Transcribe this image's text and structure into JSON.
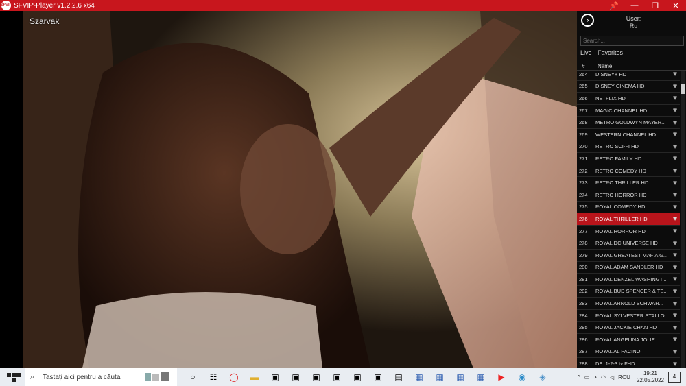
{
  "window": {
    "title": "SFVIP-Player v1.2.2.6 x64",
    "logo_text": "SFVIP",
    "controls": {
      "pin": "📌",
      "minimize": "—",
      "restore": "❐",
      "close": "✕"
    }
  },
  "video": {
    "channel_label": "Szarvak"
  },
  "panel": {
    "nav_arrow": "›",
    "user_label": "User:",
    "user_value": "Ru",
    "search_placeholder": "Search...",
    "tabs": {
      "live": "Live",
      "favorites": "Favorites"
    },
    "columns": {
      "num": "#",
      "name": "Name"
    },
    "channels": [
      {
        "num": "264",
        "name": "DISNEY+ HD"
      },
      {
        "num": "265",
        "name": "DISNEY CINEMA HD"
      },
      {
        "num": "266",
        "name": "NETFLIX HD"
      },
      {
        "num": "267",
        "name": "MAGIC CHANNEL HD"
      },
      {
        "num": "268",
        "name": "METRO GOLDWYN MAYER..."
      },
      {
        "num": "269",
        "name": "WESTERN CHANNEL HD"
      },
      {
        "num": "270",
        "name": "RETRO SCI-FI HD"
      },
      {
        "num": "271",
        "name": "RETRO FAMILY HD"
      },
      {
        "num": "272",
        "name": "RETRO COMEDY HD"
      },
      {
        "num": "273",
        "name": "RETRO THRILLER HD"
      },
      {
        "num": "274",
        "name": "RETRO HORROR HD"
      },
      {
        "num": "275",
        "name": "ROYAL COMEDY HD"
      },
      {
        "num": "276",
        "name": "ROYAL THRILLER HD",
        "selected": true
      },
      {
        "num": "277",
        "name": "ROYAL HORROR HD"
      },
      {
        "num": "278",
        "name": "ROYAL DC UNIVERSE HD"
      },
      {
        "num": "279",
        "name": "ROYAL GREATEST MAFIA G..."
      },
      {
        "num": "280",
        "name": "ROYAL ADAM SANDLER HD"
      },
      {
        "num": "281",
        "name": "ROYAL DENZEL WASHINGT..."
      },
      {
        "num": "282",
        "name": "ROYAL BUD SPENCER & TE..."
      },
      {
        "num": "283",
        "name": "ROYAL  ARNOLD SCHWAR..."
      },
      {
        "num": "284",
        "name": "ROYAL SYLVESTER STALLO..."
      },
      {
        "num": "285",
        "name": "ROYAL JACKIE CHAN HD"
      },
      {
        "num": "286",
        "name": "ROYAL ANGELINA JOLIE"
      },
      {
        "num": "287",
        "name": "ROYAL AL PACINO"
      },
      {
        "num": "288",
        "name": "DE: 1-2-3.tv FHD"
      }
    ],
    "fav_icon": "♥"
  },
  "taskbar": {
    "search_text": "Tastați aici pentru a căuta",
    "tray": {
      "chevron": "^",
      "language": "ROU",
      "time": "19:21",
      "date": "22.05.2022",
      "notif_count": "4"
    }
  },
  "colors": {
    "accent": "#c8161d",
    "selected_row": "#b8141b",
    "panel_bg": "#0c0c0c"
  }
}
